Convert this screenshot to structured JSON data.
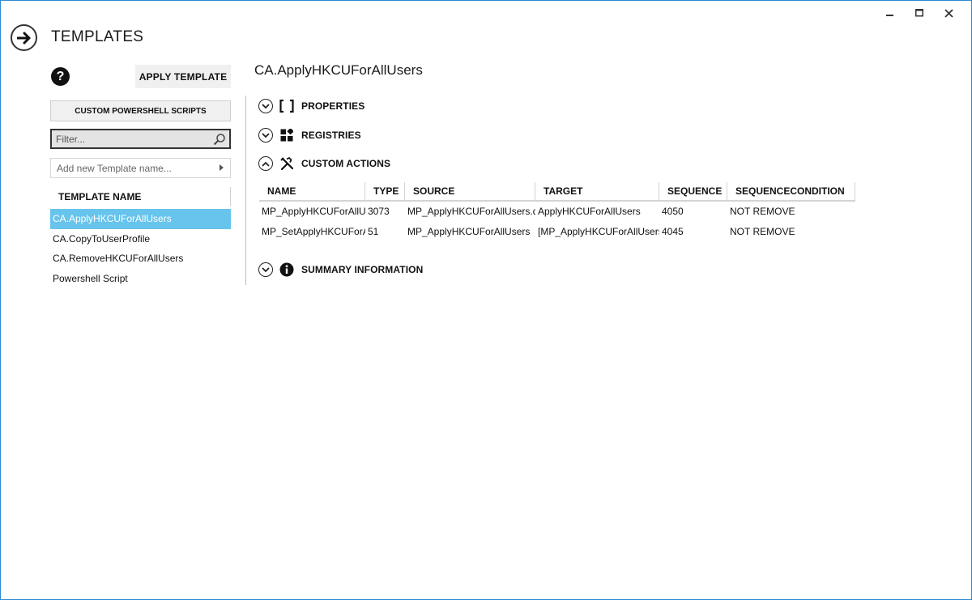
{
  "window": {
    "title": "TEMPLATES",
    "controls": [
      "minimize-icon",
      "maximize-icon",
      "close-icon"
    ]
  },
  "sidebar": {
    "apply_label": "APPLY TEMPLATE",
    "custom_ps_label": "CUSTOM POWERSHELL SCRIPTS",
    "filter_placeholder": "Filter...",
    "add_placeholder": "Add new Template name...",
    "list_header": "TEMPLATE NAME",
    "items": [
      {
        "label": "CA.ApplyHKCUForAllUsers",
        "selected": true
      },
      {
        "label": "CA.CopyToUserProfile",
        "selected": false
      },
      {
        "label": "CA.RemoveHKCUForAllUsers",
        "selected": false
      },
      {
        "label": "Powershell Script",
        "selected": false
      }
    ]
  },
  "detail": {
    "title": "CA.ApplyHKCUForAllUsers",
    "sections": {
      "properties": {
        "label": "PROPERTIES",
        "icon": "brackets-icon",
        "expanded": false
      },
      "registries": {
        "label": "REGISTRIES",
        "icon": "blocks-icon",
        "expanded": false
      },
      "custom_actions": {
        "label": "CUSTOM ACTIONS",
        "icon": "tools-icon",
        "expanded": true
      },
      "summary": {
        "label": "SUMMARY INFORMATION",
        "icon": "info-icon",
        "expanded": false
      }
    },
    "table": {
      "columns": [
        "NAME",
        "TYPE",
        "SOURCE",
        "TARGET",
        "SEQUENCE",
        "SEQUENCECONDITION"
      ],
      "rows": [
        [
          "MP_ApplyHKCUForAllUsers",
          "3073",
          "MP_ApplyHKCUForAllUsers.dll",
          "ApplyHKCUForAllUsers",
          "4050",
          "NOT REMOVE"
        ],
        [
          "MP_SetApplyHKCUForAllUsers",
          "51",
          "MP_ApplyHKCUForAllUsers",
          "[MP_ApplyHKCUForAllUsers]",
          "4045",
          "NOT REMOVE"
        ]
      ]
    }
  },
  "colors": {
    "accent_border": "#2b8ad6",
    "selected_row": "#67c4ec"
  }
}
